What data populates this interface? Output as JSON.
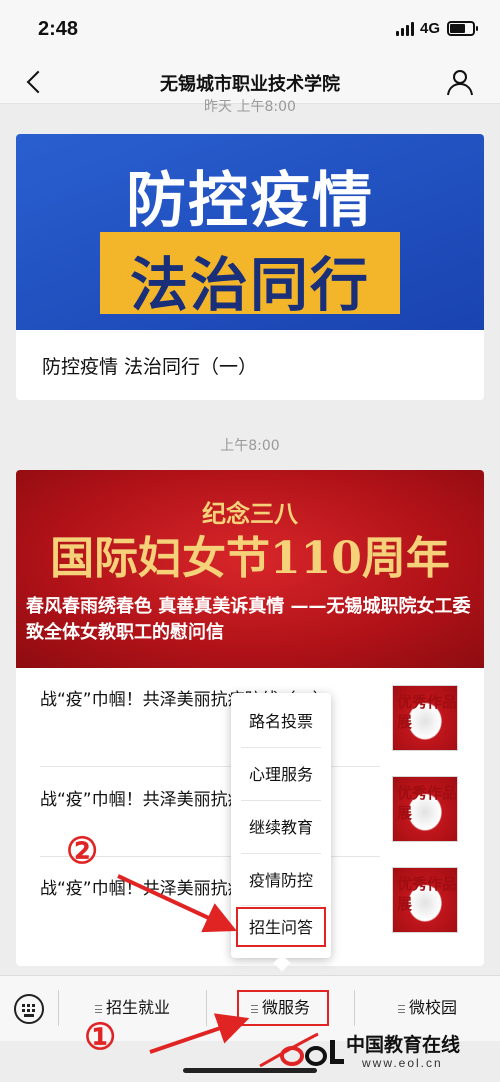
{
  "status_bar": {
    "time": "2:48",
    "network": "4G"
  },
  "nav": {
    "title": "无锡城市职业技术学院"
  },
  "timestamps": {
    "first": "昨天 上午8:00",
    "second": "上午8:00"
  },
  "article1": {
    "banner_line1": "防控疫情",
    "banner_line2": "法治同行",
    "title": "防控疫情 法治同行（一）"
  },
  "article2": {
    "banner_line1": "纪念三八",
    "banner_line2": "国际妇女节110周年",
    "headline": "春风春雨绣春色 真善真美诉真情 ——无锡城职院女工委致全体女教职工的慰问信",
    "items": [
      {
        "title": "战“疫”巾帼！共泽美丽抗疫防线（一）",
        "thumb": "优秀作品展"
      },
      {
        "title": "战“疫”巾帼！共泽美丽抗疫防线（二）",
        "thumb": "优秀作品展"
      },
      {
        "title": "战“疫”巾帼！共泽美丽抗疫防线（三）",
        "thumb": "优秀作品展"
      }
    ]
  },
  "popup_menu": {
    "items": [
      "路名投票",
      "心理服务",
      "继续教育",
      "疫情防控",
      "招生问答"
    ],
    "highlighted": "招生问答"
  },
  "bottom_tabs": [
    "招生就业",
    "微服务",
    "微校园"
  ],
  "annotations": {
    "step1": "①",
    "step2": "②",
    "highlight_color": "#e02424"
  },
  "watermark": {
    "text": "中国教育在线",
    "url": "www.eol.cn",
    "logo_text": "eol"
  }
}
